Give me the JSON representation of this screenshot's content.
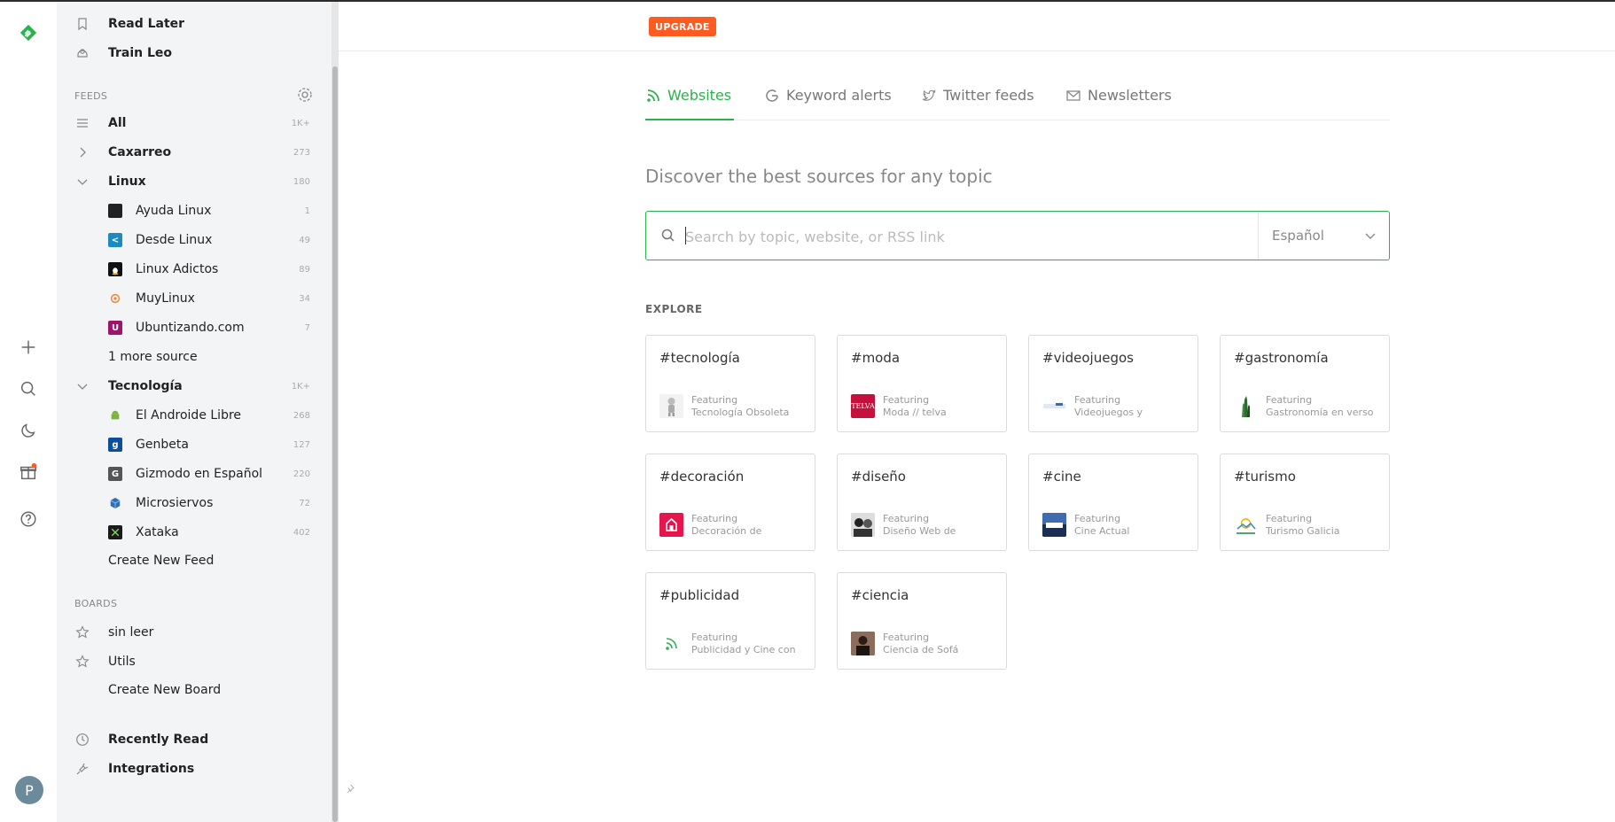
{
  "sidebar": {
    "top_items": [
      {
        "label": "Read Later",
        "icon": "bookmark-icon"
      },
      {
        "label": "Train Leo",
        "icon": "leo-icon"
      }
    ],
    "feeds_header": "FEEDS",
    "all": {
      "label": "All",
      "count": "1K+"
    },
    "folders": [
      {
        "label": "Caxarreo",
        "count": "273",
        "expanded": false
      },
      {
        "label": "Linux",
        "count": "180",
        "expanded": true
      },
      {
        "label": "Tecnología",
        "count": "1K+",
        "expanded": true
      }
    ],
    "linux_sources": [
      {
        "label": "Ayuda Linux",
        "count": "1",
        "color": "#222222"
      },
      {
        "label": "Desde Linux",
        "count": "49",
        "color": "#1c8bc0"
      },
      {
        "label": "Linux Adictos",
        "count": "89",
        "color": "#111111"
      },
      {
        "label": "MuyLinux",
        "count": "34",
        "color": "#f08030"
      },
      {
        "label": "Ubuntizando.com",
        "count": "7",
        "color": "#a0136b"
      }
    ],
    "more_sources": "1 more source",
    "tecnologia_sources": [
      {
        "label": "El Androide Libre",
        "count": "268",
        "color": "#7cb342"
      },
      {
        "label": "Genbeta",
        "count": "127",
        "color": "#0b4f9c"
      },
      {
        "label": "Gizmodo en Español",
        "count": "220",
        "color": "#555555"
      },
      {
        "label": "Microsiervos",
        "count": "72",
        "color": "#2f6fb5"
      },
      {
        "label": "Xataka",
        "count": "402",
        "color": "#1a1a1a"
      }
    ],
    "create_feed": "Create New Feed",
    "boards_header": "BOARDS",
    "boards": [
      {
        "label": "sin leer"
      },
      {
        "label": "Utils"
      }
    ],
    "create_board": "Create New Board",
    "bottom_items": [
      {
        "label": "Recently Read",
        "icon": "clock-icon"
      },
      {
        "label": "Integrations",
        "icon": "plug-icon"
      }
    ]
  },
  "rail": {
    "avatar_letter": "P",
    "brand_color": "#2bb24c"
  },
  "main": {
    "upgrade_label": "UPGRADE",
    "tabs": [
      {
        "label": "Websites",
        "icon": "rss-icon",
        "active": true
      },
      {
        "label": "Keyword alerts",
        "icon": "google-icon",
        "active": false
      },
      {
        "label": "Twitter feeds",
        "icon": "twitter-icon",
        "active": false
      },
      {
        "label": "Newsletters",
        "icon": "mail-icon",
        "active": false
      }
    ],
    "discover_title": "Discover the best sources for any topic",
    "search": {
      "placeholder": "Search by topic, website, or RSS link",
      "value": ""
    },
    "language": "Español",
    "explore_header": "EXPLORE",
    "featuring_label": "Featuring",
    "topics": [
      {
        "tag": "#tecnología",
        "source": "Tecnología Obsoleta",
        "color": "#cfcfcf"
      },
      {
        "tag": "#moda",
        "source": "Moda // telva",
        "color": "#c4103a"
      },
      {
        "tag": "#videojuegos",
        "source": "Videojuegos y",
        "color": "#ffffff"
      },
      {
        "tag": "#gastronomía",
        "source": "Gastronomía en verso",
        "color": "#ffffff"
      },
      {
        "tag": "#decoración",
        "source": "Decoración de",
        "color": "#e6164d"
      },
      {
        "tag": "#diseño",
        "source": "Diseño Web de",
        "color": "#444444"
      },
      {
        "tag": "#cine",
        "source": "Cine Actual",
        "color": "#2d4f8a"
      },
      {
        "tag": "#turismo",
        "source": "Turismo Galicia",
        "color": "#ffffff"
      },
      {
        "tag": "#publicidad",
        "source": "Publicidad y Cine con",
        "color": "#ffffff"
      },
      {
        "tag": "#ciencia",
        "source": "Ciencia de Sofá",
        "color": "#6b4a3a"
      }
    ]
  }
}
